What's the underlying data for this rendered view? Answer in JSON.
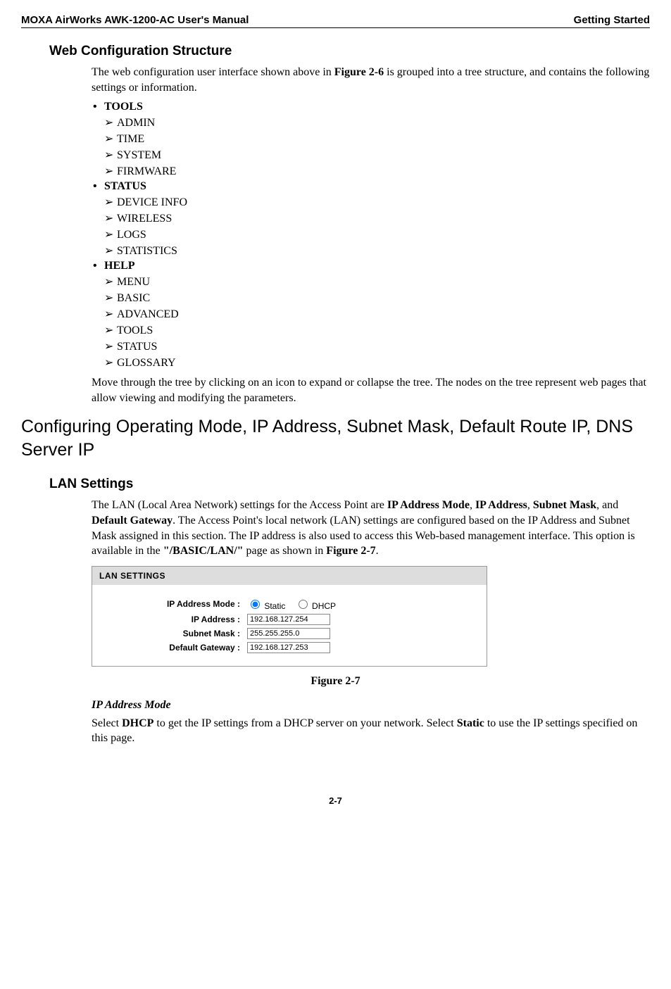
{
  "header": {
    "left": "MOXA AirWorks AWK-1200-AC User's Manual",
    "right": "Getting Started"
  },
  "h2_1": "Web Configuration Structure",
  "p1": "The web configuration user interface shown above in ",
  "p1_bold": "Figure 2-6",
  "p1_tail": " is grouped into a tree structure, and contains the following settings or information.",
  "tree": [
    {
      "label": "TOOLS",
      "items": [
        "ADMIN",
        "TIME",
        "SYSTEM",
        "FIRMWARE"
      ]
    },
    {
      "label": "STATUS",
      "items": [
        "DEVICE INFO",
        "WIRELESS",
        "LOGS",
        "STATISTICS"
      ]
    },
    {
      "label": "HELP",
      "items": [
        "MENU",
        "BASIC",
        "ADVANCED",
        "TOOLS",
        "STATUS",
        "GLOSSARY"
      ]
    }
  ],
  "p2": "Move through the tree by clicking on an icon to expand or collapse the tree. The nodes on the tree represent web pages that allow viewing and modifying the parameters.",
  "h1": "Configuring Operating Mode, IP Address, Subnet Mask, Default Route IP, DNS Server IP",
  "h2_2": "LAN Settings",
  "p3a": "The LAN (Local Area Network) settings for the Access Point are ",
  "p3b1": "IP Address Mode",
  "p3c": ", ",
  "p3b2": "IP Address",
  "p3d": ", ",
  "p3b3": "Subnet Mask",
  "p3e": ", and ",
  "p3b4": "Default Gateway",
  "p3f": ". The Access Point's local network (LAN) settings are configured based on the IP Address and Subnet Mask assigned in this section. The IP address is also used to access this Web-based management interface. This option is available in the ",
  "p3b5": "\"/BASIC/LAN/\"",
  "p3g": " page as shown in ",
  "p3b6": "Figure 2-7",
  "p3h": ".",
  "figure": {
    "title": "LAN SETTINGS",
    "rows": {
      "mode_label": "IP Address Mode :",
      "static_label": "Static",
      "dhcp_label": "DHCP",
      "ip_label": "IP Address :",
      "ip_value": "192.168.127.254",
      "mask_label": "Subnet Mask :",
      "mask_value": "255.255.255.0",
      "gw_label": "Default Gateway :",
      "gw_value": "192.168.127.253"
    },
    "caption": "Figure 2-7"
  },
  "subhead": "IP Address Mode",
  "p4a": "Select ",
  "p4b1": "DHCP",
  "p4b": " to get the IP settings from a DHCP server on your network. Select ",
  "p4b2": "Static",
  "p4c": " to use the IP settings specified on this page.",
  "pagenum": "2-7"
}
